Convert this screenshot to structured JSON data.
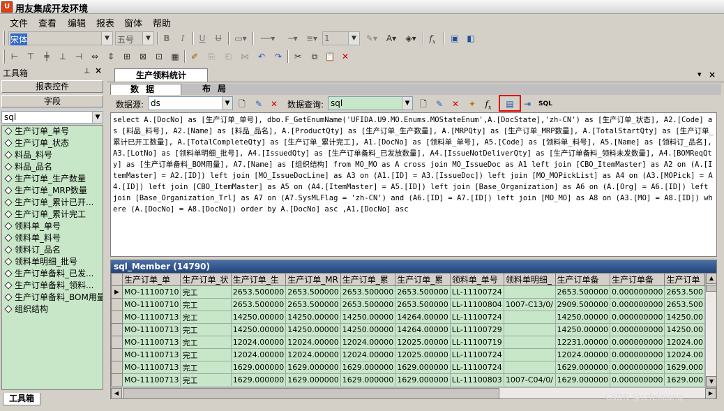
{
  "window": {
    "title": "用友集成开发环境",
    "app_icon": "U"
  },
  "menu": [
    "文件",
    "查看",
    "编辑",
    "报表",
    "窗体",
    "帮助"
  ],
  "format_toolbar": {
    "font_name": "宋体",
    "font_size": "五号",
    "line_width": "1"
  },
  "left_panel": {
    "title": "工具箱",
    "buttons": [
      "报表控件",
      "字段"
    ],
    "datasource": "sql",
    "fields": [
      "生产订单_单号",
      "生产订单_状态",
      "料品_料号",
      "料品_品名",
      "生产订单_生产数量",
      "生产订单_MRP数量",
      "生产订单_累计已开...",
      "生产订单_累计完工",
      "领料单_单号",
      "领料单_料号",
      "领料订_品名",
      "领料单明细_批号",
      "生产订单备料_已发...",
      "生产订单备料_领料...",
      "生产订单备料_BOM用量",
      "组织结构"
    ],
    "bottom_tab": "工具箱"
  },
  "document": {
    "tab_title": "生产领料统计",
    "sub_tabs": [
      "数据",
      "布局"
    ],
    "query_toolbar": {
      "datasource_label": "数据源:",
      "datasource_value": "ds",
      "query_label": "数据查询:",
      "query_value": "sql"
    },
    "sql_text": "select  A.[DocNo] as [生产订单_单号], dbo.F_GetEnumName('UFIDA.U9.MO.Enums.MOStateEnum',A.[DocState],'zh-CN') as [生产订单_状态], A2.[Code] as [料品_料号], A2.[Name] as [料品_品名], A.[ProductQty] as [生产订单_生产数量], A.[MRPQty] as [生产订单_MRP数量], A.[TotalStartQty] as [生产订单_累计已开工数量], A.[TotalCompleteQty] as [生产订单_累计完工], A1.[DocNo] as [领料单_单号], A5.[Code] as [领料单_料号], A5.[Name] as [领料订_品名], A3.[LotNo] as [领料单明细_批号], A4.[IssuedQty] as [生产订单备料_已发放数量], A4.[IssueNotDeliverQty] as [生产订单备料_领料未发数量], A4.[BOMReqQty] as [生产订单备料_BOM用量], A7.[Name] as [组织结构] from  MO_MO as A  cross join MO_IssueDoc as A1  left join [CBO_ItemMaster] as A2 on (A.[ItemMaster] = A2.[ID])  left join [MO_IssueDocLine] as A3 on (A1.[ID] = A3.[IssueDoc])  left join [MO_MOPickList] as A4 on (A3.[MOPick] = A4.[ID])  left join [CBO_ItemMaster] as A5 on (A4.[ItemMaster] = A5.[ID])  left join [Base_Organization] as A6 on (A.[Org] = A6.[ID])  left join [Base_Organization_Trl] as A7 on (A7.SysMLFlag = 'zh-CN') and (A6.[ID] = A7.[ID])  left join [MO_MO] as A8 on (A3.[MO] = A8.[ID]) where (A.[DocNo] = A8.[DocNo]) order by A.[DocNo] asc ,A1.[DocNo] asc",
    "grid": {
      "title": "sql_Member (14790)",
      "columns": [
        "生产订单_单",
        "生产订单_状",
        "生产订单_生",
        "生产订单_MR",
        "生产订单_累",
        "生产订单_累",
        "领料单_单号",
        "领料单明细_",
        "生产订单备",
        "生产订单备",
        "生产订单"
      ],
      "rows": [
        [
          "MO-11100710",
          "完工",
          "2653.500000",
          "2653.500000",
          "2653.500000",
          "2653.500000",
          "LL-11100724",
          "",
          "2653.500000",
          "0.000000000",
          "2653.500"
        ],
        [
          "MO-11100710",
          "完工",
          "2653.500000",
          "2653.500000",
          "2653.500000",
          "2653.500000",
          "LL-11100804",
          "1007-C13/0/",
          "2909.500000",
          "0.000000000",
          "2653.500"
        ],
        [
          "MO-11100713",
          "完工",
          "14250.00000",
          "14250.00000",
          "14250.00000",
          "14264.00000",
          "LL-11100724",
          "",
          "14250.00000",
          "0.000000000",
          "14250.00"
        ],
        [
          "MO-11100713",
          "完工",
          "14250.00000",
          "14250.00000",
          "14250.00000",
          "14264.00000",
          "LL-11100729",
          "",
          "14250.00000",
          "0.000000000",
          "14250.00"
        ],
        [
          "MO-11100713",
          "完工",
          "12024.00000",
          "12024.00000",
          "12024.00000",
          "12025.00000",
          "LL-11100719",
          "",
          "12231.00000",
          "0.000000000",
          "12024.00"
        ],
        [
          "MO-11100713",
          "完工",
          "12024.00000",
          "12024.00000",
          "12024.00000",
          "12025.00000",
          "LL-11100724",
          "",
          "12024.00000",
          "0.000000000",
          "12024.00"
        ],
        [
          "MO-11100713",
          "完工",
          "1629.000000",
          "1629.000000",
          "1629.000000",
          "1629.000000",
          "LL-11100724",
          "",
          "1629.000000",
          "0.000000000",
          "1629.000"
        ],
        [
          "MO-11100713",
          "完工",
          "1629.000000",
          "1629.000000",
          "1629.000000",
          "1629.000000",
          "LL-11100803",
          "1007-C04/0/",
          "1629.000000",
          "0.000000000",
          "1629.000"
        ]
      ]
    }
  },
  "watermark": "CSDN @czfeixiang"
}
